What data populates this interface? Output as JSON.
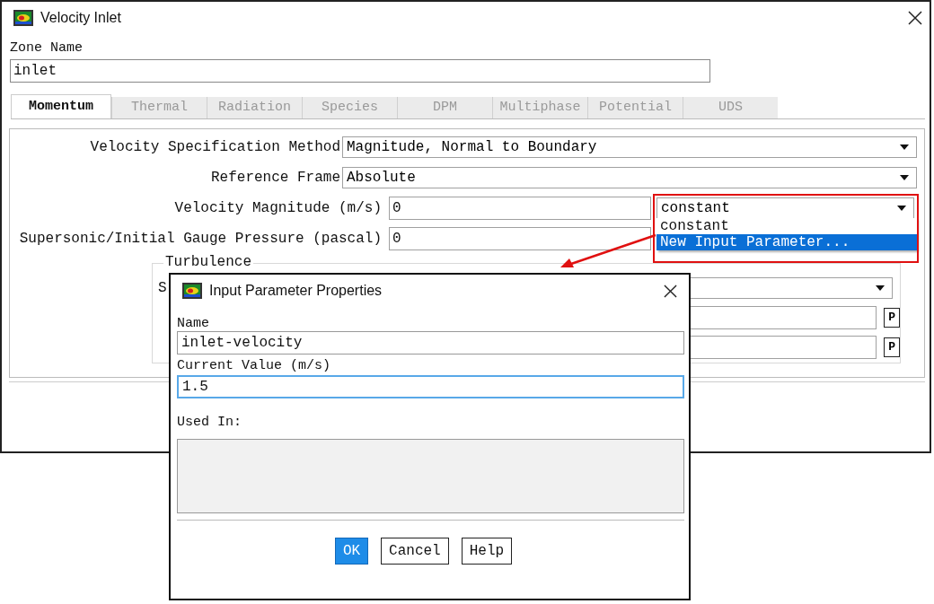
{
  "window": {
    "title": "Velocity Inlet"
  },
  "zone_name": {
    "label": "Zone Name",
    "value": "inlet"
  },
  "tabs": [
    {
      "label": "Momentum",
      "selected": true
    },
    {
      "label": "Thermal",
      "selected": false
    },
    {
      "label": "Radiation",
      "selected": false
    },
    {
      "label": "Species",
      "selected": false
    },
    {
      "label": "DPM",
      "selected": false
    },
    {
      "label": "Multiphase",
      "selected": false
    },
    {
      "label": "Potential",
      "selected": false
    },
    {
      "label": "UDS",
      "selected": false
    }
  ],
  "fields": [
    {
      "kind": "dropdown",
      "label": "Velocity Specification Method",
      "value": "Magnitude, Normal to Boundary"
    },
    {
      "kind": "dropdown",
      "label": "Reference Frame",
      "value": "Absolute"
    },
    {
      "kind": "input",
      "label": "Velocity Magnitude (m/s)",
      "value": "0",
      "method": "constant"
    },
    {
      "kind": "input",
      "label": "Supersonic/Initial Gauge Pressure (pascal)",
      "value": "0"
    }
  ],
  "method_list": [
    {
      "label": "constant",
      "selected": false
    },
    {
      "label": "New Input Parameter...",
      "selected": true
    }
  ],
  "turbulence": {
    "title": "Turbulence",
    "label": "S",
    "param_buttons": [
      "P",
      "P"
    ]
  },
  "dialog": {
    "title": "Input Parameter Properties",
    "name_label": "Name",
    "name_value": "inlet-velocity",
    "value_label": "Current Value (m/s)",
    "value": "1.5",
    "used_in_label": "Used In:",
    "buttons": [
      {
        "label": "OK",
        "default": true
      },
      {
        "label": "Cancel",
        "default": false
      },
      {
        "label": "Help",
        "default": false
      }
    ]
  }
}
